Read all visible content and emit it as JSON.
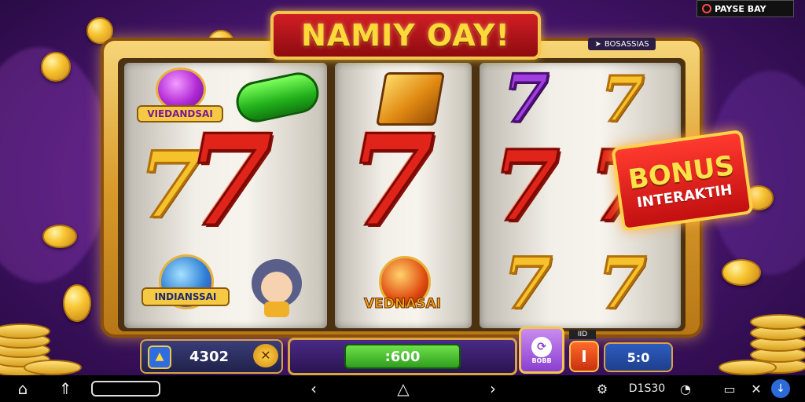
{
  "game": {
    "title": "NAMIY OAY!",
    "top_tag": "BOSASSIAS",
    "top_right_label": "PAYSE BAY"
  },
  "symbols": {
    "reel1_top_label": "VIEDANDSAI",
    "reel1_bottom_label": "INDIANSSAI",
    "reel2_bottom_label": "VEDNASAI",
    "seven_glyph": "7"
  },
  "bonus": {
    "title": "BONUS",
    "subtitle": "INTERAKTIH"
  },
  "controls": {
    "balance": "4302",
    "win_display": ":600",
    "bet_value": "5:0",
    "mini_label": "IID",
    "purple_button_label": "BOBB"
  },
  "navbar": {
    "clock": "D1S30",
    "icons": [
      "home-icon",
      "recent-icon",
      "window-icon",
      "back-icon",
      "home-nav-icon",
      "forward-icon",
      "gear-icon",
      "clock-icon",
      "screen-icon",
      "close-icon",
      "help-icon"
    ]
  },
  "colors": {
    "frame_gold": "#d99a2b",
    "title_red": "#c3161b",
    "seven_red": "#e0241a",
    "seven_yellow": "#f6c22b",
    "seven_purple": "#a23ee0",
    "win_green": "#2f9e1e",
    "bet_blue": "#1e3f8c"
  }
}
